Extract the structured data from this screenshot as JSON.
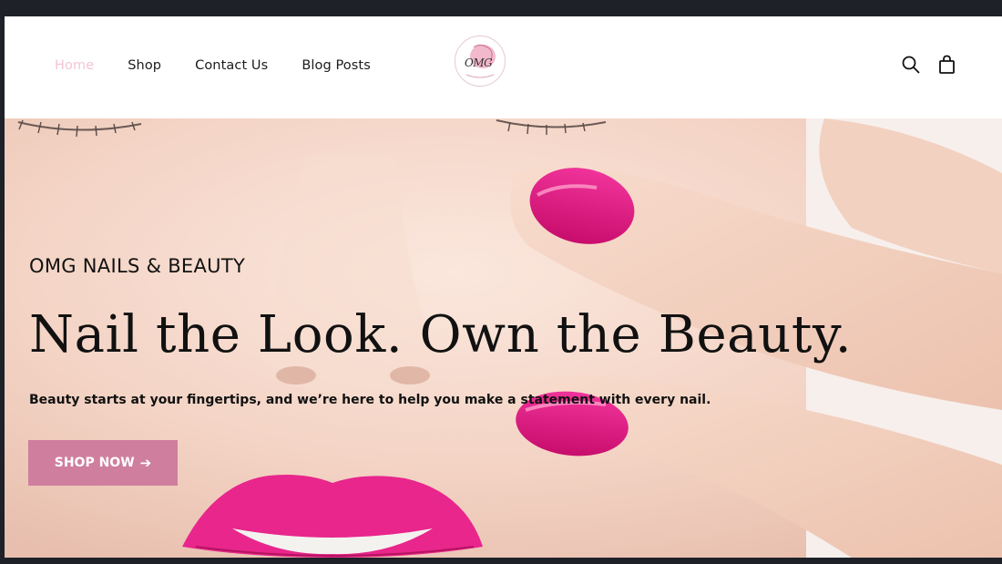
{
  "nav": {
    "items": [
      {
        "label": "Home",
        "active": true
      },
      {
        "label": "Shop",
        "active": false
      },
      {
        "label": "Contact Us",
        "active": false
      },
      {
        "label": "Blog Posts",
        "active": false
      }
    ]
  },
  "logo": {
    "text": "OMG"
  },
  "header_icons": [
    "search-icon",
    "shopping-bag-icon"
  ],
  "hero": {
    "eyebrow": "OMG NAILS & BEAUTY",
    "headline": "Nail the Look. Own the Beauty.",
    "subline": "Beauty starts at your fingertips, and we’re here to help you make a statement with every nail.",
    "cta_label": "SHOP NOW",
    "cta_icon": "arrow-right-icon"
  },
  "colors": {
    "active_nav": "#f4c4d6",
    "cta_background": "#cf7e9e",
    "nail_pink": "#e0157f",
    "lip_pink": "#e8268c"
  }
}
